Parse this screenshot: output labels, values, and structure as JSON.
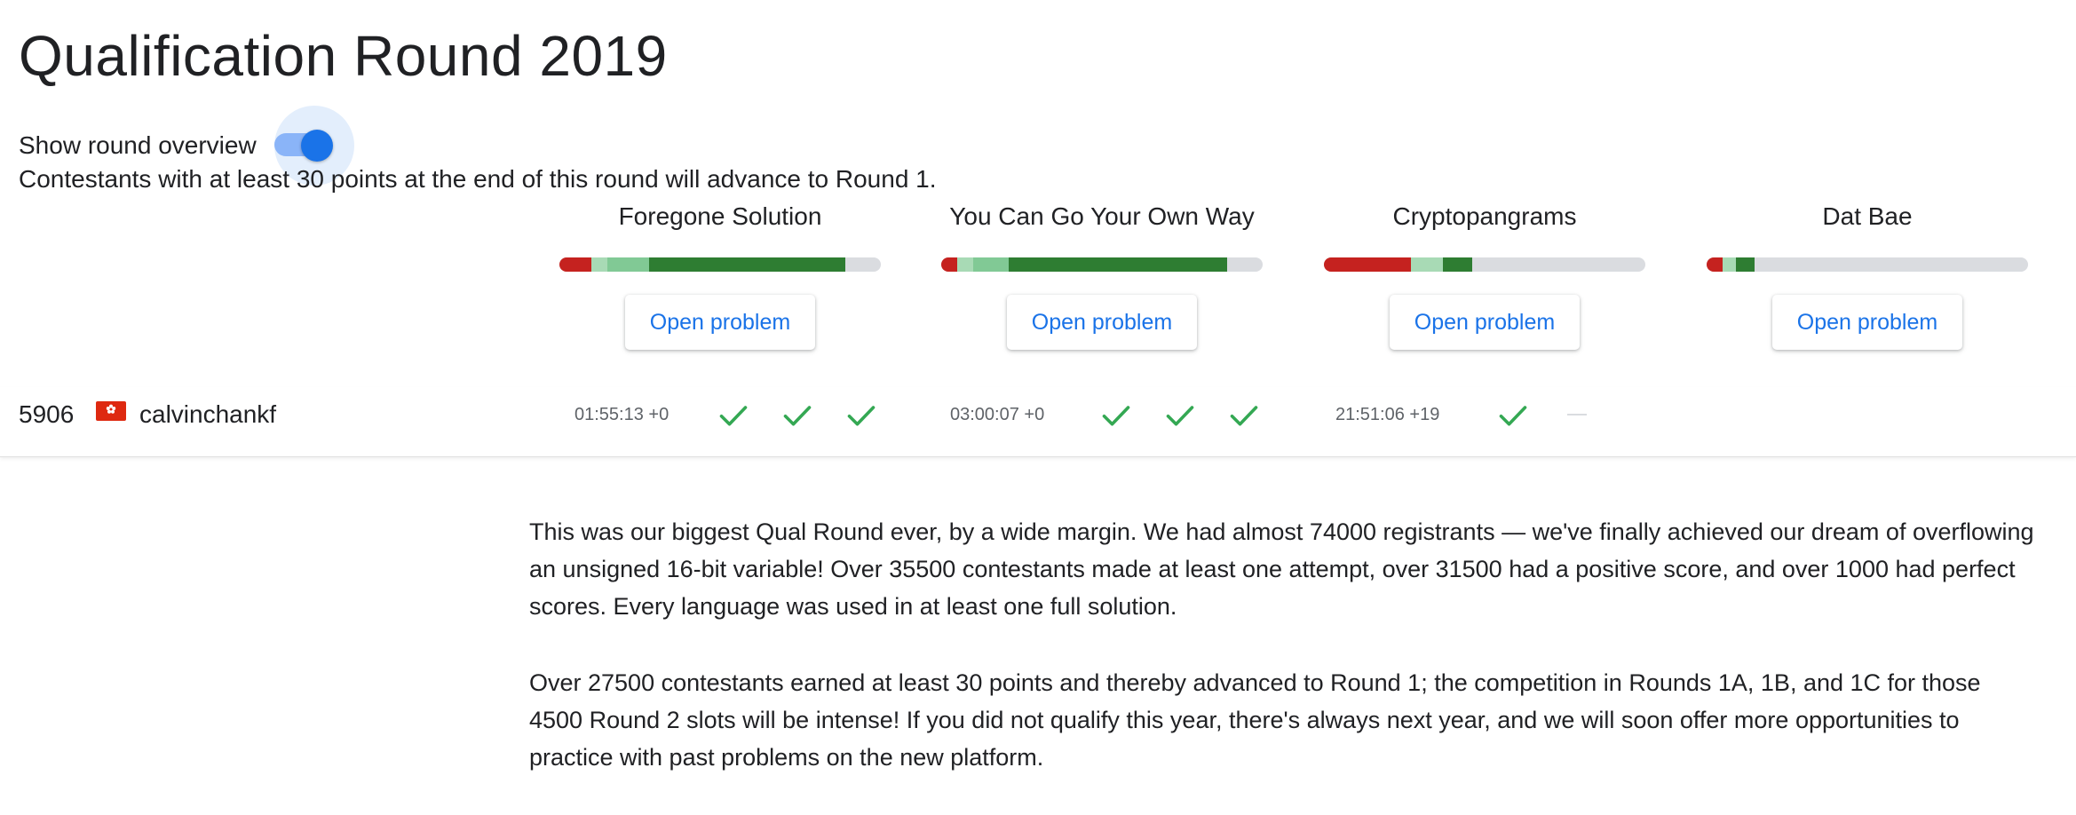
{
  "page": {
    "title": "Qualification Round 2019",
    "overview_toggle": {
      "label": "Show round overview",
      "on": true
    },
    "advance_note": "Contestants with at least 30 points at the end of this round will advance to Round 1."
  },
  "colors": {
    "accent": "#1a73e8",
    "bar_wrong": "#c5221f",
    "bar_light": "#a8dab5",
    "bar_mid": "#81c995",
    "bar_full": "#2e7d32",
    "bar_empty": "#dadce0",
    "check": "#34a853"
  },
  "problems": [
    {
      "name": "Foregone Solution",
      "button": "Open problem",
      "stats": [
        {
          "kind": "wrong",
          "fraction": 0.1
        },
        {
          "kind": "light",
          "fraction": 0.05
        },
        {
          "kind": "mid",
          "fraction": 0.13
        },
        {
          "kind": "full",
          "fraction": 0.61
        }
      ]
    },
    {
      "name": "You Can Go Your Own Way",
      "button": "Open problem",
      "stats": [
        {
          "kind": "wrong",
          "fraction": 0.05
        },
        {
          "kind": "light",
          "fraction": 0.05
        },
        {
          "kind": "mid",
          "fraction": 0.11
        },
        {
          "kind": "full",
          "fraction": 0.68
        }
      ]
    },
    {
      "name": "Cryptopangrams",
      "button": "Open problem",
      "stats": [
        {
          "kind": "wrong",
          "fraction": 0.27
        },
        {
          "kind": "light",
          "fraction": 0.1
        },
        {
          "kind": "full",
          "fraction": 0.09
        }
      ]
    },
    {
      "name": "Dat Bae",
      "button": "Open problem",
      "stats": [
        {
          "kind": "wrong",
          "fraction": 0.05
        },
        {
          "kind": "light",
          "fraction": 0.04
        },
        {
          "kind": "full",
          "fraction": 0.06
        }
      ]
    }
  ],
  "contestant": {
    "rank": "5906",
    "country_flag": "hong-kong-flag-icon",
    "username": "calvinchankf",
    "results": [
      {
        "time": "01:55:13 +0",
        "tests": [
          "check",
          "check",
          "check"
        ]
      },
      {
        "time": "03:00:07 +0",
        "tests": [
          "check",
          "check",
          "check"
        ]
      },
      {
        "time": "21:51:06 +19",
        "tests": [
          "check",
          "dash"
        ]
      },
      {
        "time": "",
        "tests": []
      }
    ]
  },
  "body_paragraphs": [
    "This was our biggest Qual Round ever, by a wide margin. We had almost 74000 registrants — we've finally achieved our dream of overflowing an unsigned 16-bit variable! Over 35500 contestants made at least one attempt, over 31500 had a positive score, and over 1000 had perfect scores. Every language was used in at least one full solution.",
    "Over 27500 contestants earned at least 30 points and thereby advanced to Round 1; the competition in Rounds 1A, 1B, and 1C for those 4500 Round 2 slots will be intense! If you did not qualify this year, there's always next year, and we will soon offer more opportunities to practice with past problems on the new platform."
  ]
}
